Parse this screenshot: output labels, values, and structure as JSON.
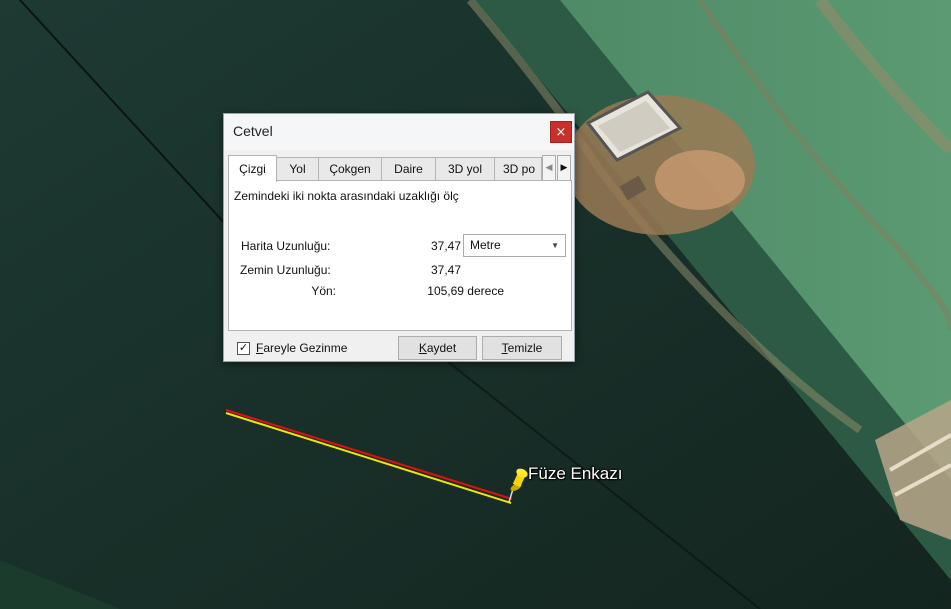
{
  "dialog": {
    "title": "Cetvel",
    "close_label": "×",
    "tabs": [
      "Çizgi",
      "Yol",
      "Çokgen",
      "Daire",
      "3D yol",
      "3D po"
    ],
    "active_tab": "Çizgi",
    "description": "Zemindeki iki nokta arasındaki uzaklığı ölç",
    "map_length_label": "Harita Uzunluğu:",
    "map_length_value": "37,47",
    "unit": "Metre",
    "ground_length_label": "Zemin Uzunluğu:",
    "ground_length_value": "37,47",
    "heading_label": "Yön:",
    "heading_value": "105,69 derece",
    "mouse_nav_label": "Fareyle Gezinme",
    "mouse_nav_checked": true,
    "save_label": "Kaydet",
    "clear_label": "Temizle"
  },
  "map": {
    "placemark_label": "Füze Enkazı",
    "ruler_color": "#e01010",
    "ruler_highlight": "#f2e600",
    "pin_color": "#f5d800"
  }
}
